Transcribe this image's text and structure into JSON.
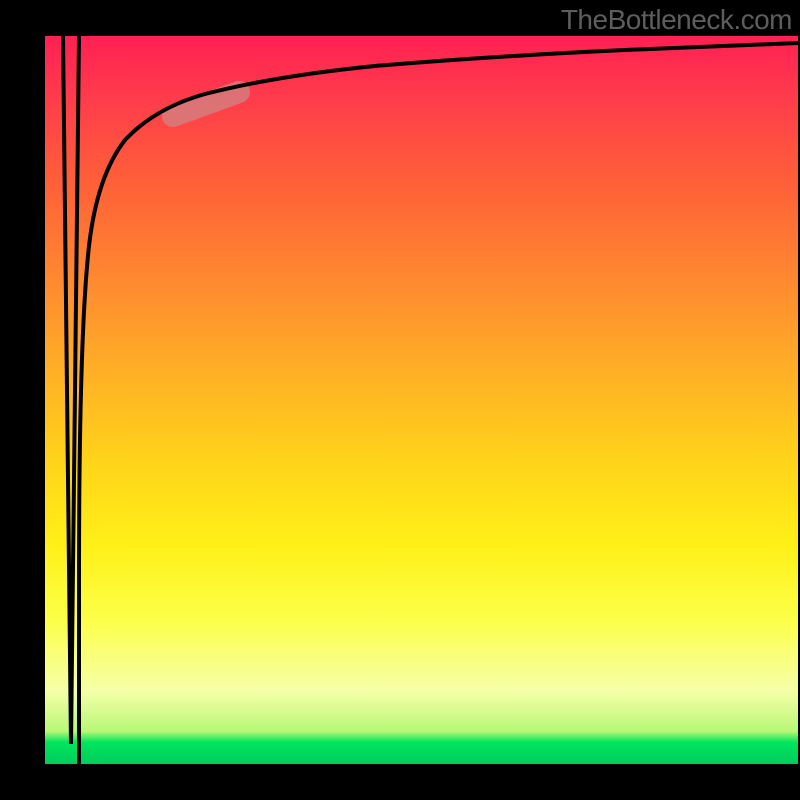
{
  "watermark": "TheBottleneck.com",
  "chart_data": {
    "type": "line",
    "title": "",
    "xlabel": "",
    "ylabel": "",
    "xlim": [
      0,
      100
    ],
    "ylim": [
      0,
      100
    ],
    "series": [
      {
        "name": "spike",
        "x": [
          2.5,
          3.5,
          4.5
        ],
        "y": [
          100,
          3,
          100
        ]
      },
      {
        "name": "main-curve",
        "x": [
          4.5,
          5,
          6,
          8,
          10,
          12,
          15,
          20,
          30,
          50,
          70,
          85,
          100
        ],
        "y": [
          100,
          75,
          55,
          35,
          25,
          18,
          13,
          10,
          7.5,
          5.5,
          4.5,
          4,
          3.5
        ]
      }
    ],
    "highlight": {
      "name": "curve-highlight-pill",
      "x_range": [
        19,
        27
      ],
      "y_range": [
        10.5,
        8.2
      ]
    },
    "gradient_stops": [
      {
        "pct": 0,
        "color": "#ff2052"
      },
      {
        "pct": 34,
        "color": "#ff8a30"
      },
      {
        "pct": 70,
        "color": "#fff018"
      },
      {
        "pct": 97,
        "color": "#00e65d"
      }
    ]
  }
}
